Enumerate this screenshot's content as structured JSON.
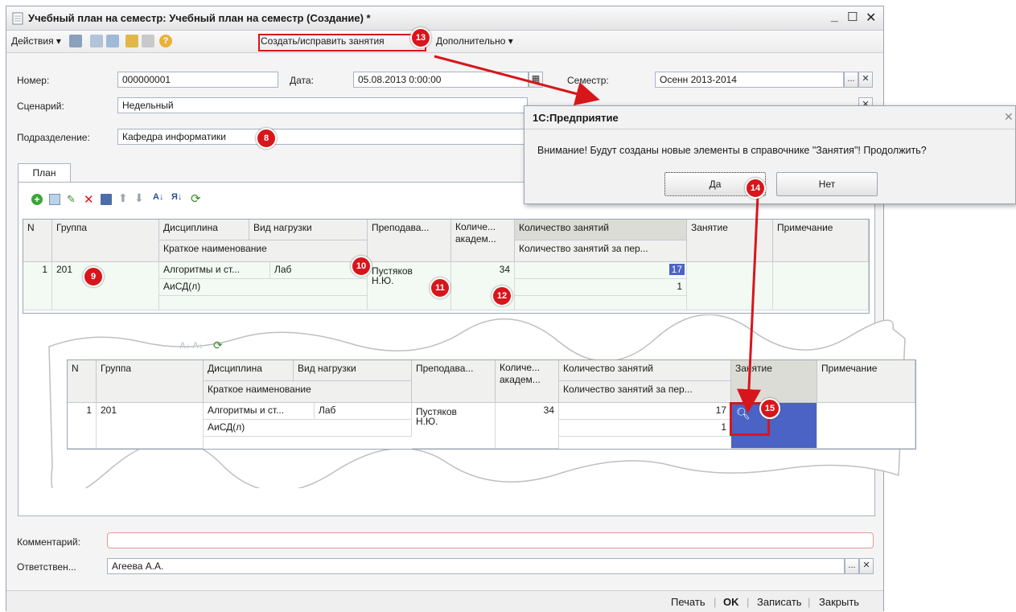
{
  "window": {
    "title": "Учебный план на семестр: Учебный план на семестр (Создание) *"
  },
  "toolbar": {
    "actions_label": "Действия",
    "create_fix_label": "Создать/исправить занятия",
    "additional_label": "Дополнительно"
  },
  "form": {
    "number_label": "Номер:",
    "number_value": "000000001",
    "date_label": "Дата:",
    "date_value": "05.08.2013  0:00:00",
    "semester_label": "Семестр:",
    "semester_value": "Осенн 2013-2014",
    "scenario_label": "Сценарий:",
    "scenario_value": "Недельный",
    "department_label": "Подразделение:",
    "department_value": "Кафедра информатики",
    "comment_label": "Комментарий:",
    "comment_value": "",
    "responsible_label": "Ответствен...",
    "responsible_value": "Агеева А.А."
  },
  "tab": {
    "label": "План"
  },
  "grid": {
    "headers": {
      "n": "N",
      "group": "Группа",
      "discipline": "Дисциплина",
      "load_type": "Вид нагрузки",
      "short_name": "Краткое наименование",
      "teacher": "Преподава...",
      "count": "Количе...",
      "count2": "академ...",
      "lessons": "Количество занятий",
      "lessons_per": "Количество занятий за пер...",
      "lesson": "Занятие",
      "note": "Примечание"
    },
    "row": {
      "n": "1",
      "group": "201",
      "discipline": "Алгоритмы и ст...",
      "load_type": "Лаб",
      "short_name": "АиСД(л)",
      "teacher": "Пустяков",
      "teacher2": "Н.Ю.",
      "count": "34",
      "lessons": "17",
      "lessons_per": "1"
    }
  },
  "grid2": {
    "headers": {
      "n": "N",
      "group": "Группа",
      "discipline": "Дисциплина",
      "load_type": "Вид нагрузки",
      "short_name": "Краткое наименование",
      "teacher": "Преподава...",
      "count": "Количе...",
      "count2": "академ...",
      "lessons": "Количество занятий",
      "lessons_per": "Количество занятий за пер...",
      "lesson": "Занятие",
      "note": "Примечание"
    },
    "row": {
      "n": "1",
      "group": "201",
      "discipline": "Алгоритмы и ст...",
      "load_type": "Лаб",
      "short_name": "АиСД(л)",
      "teacher": "Пустяков",
      "teacher2": "Н.Ю.",
      "count": "34",
      "lessons": "17",
      "lessons_per": "1"
    }
  },
  "dialog": {
    "title": "1С:Предприятие",
    "message": "Внимание! Будут созданы новые элементы в справочнике \"Занятия\"! Продолжить?",
    "yes": "Да",
    "no": "Нет"
  },
  "bottom": {
    "print": "Печать",
    "ok": "OK",
    "save": "Записать",
    "close": "Закрыть"
  },
  "badges": {
    "b8": "8",
    "b9": "9",
    "b10": "10",
    "b11": "11",
    "b12": "12",
    "b13": "13",
    "b14": "14",
    "b15": "15"
  },
  "colors": {
    "accent_red": "#d7161b",
    "selection_blue": "#4a63c4",
    "window_bg": "#f4f4f4"
  },
  "icons": [
    "document-icon",
    "minimize-icon",
    "maximize-icon",
    "close-icon",
    "help-icon",
    "calendar-icon",
    "add-icon",
    "copy-icon",
    "edit-icon",
    "delete-icon",
    "save-icon",
    "arrow-up-icon",
    "arrow-down-icon",
    "sort-asc-icon",
    "sort-desc-icon",
    "refresh-icon",
    "magnifier-icon"
  ]
}
